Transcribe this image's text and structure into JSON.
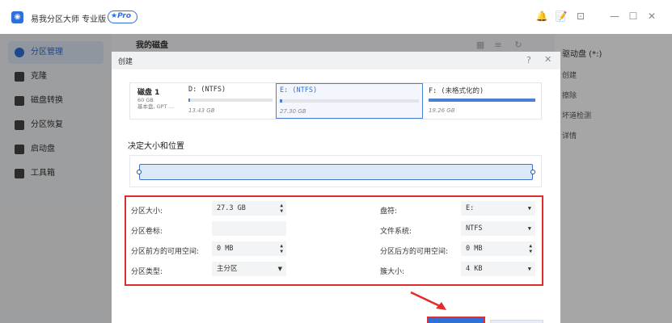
{
  "app": {
    "logo": "◉",
    "title": "易我分区大师 专业版",
    "badge": "★Pro",
    "window_icons": [
      "bell-icon",
      "note-icon",
      "download-icon",
      "minimize-icon",
      "maximize-icon",
      "close-icon"
    ],
    "window_glyphs": [
      "🔔",
      "📝",
      "⊡",
      "—",
      "☐",
      "✕"
    ]
  },
  "sidebar": {
    "items": [
      {
        "label": "分区管理",
        "active": true
      },
      {
        "label": "克隆",
        "active": false
      },
      {
        "label": "磁盘转换",
        "active": false
      },
      {
        "label": "分区恢复",
        "active": false
      },
      {
        "label": "启动盘",
        "active": false
      },
      {
        "label": "工具箱",
        "active": false
      }
    ]
  },
  "main": {
    "header": "我的磁盘",
    "view_glyphs": [
      "▦",
      "≡",
      "↻"
    ]
  },
  "right_panel": {
    "title": "驱动盘 (*:)",
    "items": [
      "创建",
      "擦除",
      "坏道检测",
      "详情"
    ]
  },
  "dialog": {
    "title": "创建",
    "help": "?",
    "close": "✕",
    "disk": {
      "name": "磁盘 1",
      "meta1": "60 GB",
      "meta2": "基本盘, GPT …",
      "partitions": [
        {
          "label": "D: (NTFS)",
          "size": "13.43 GB",
          "usage": 0.02,
          "selected": false
        },
        {
          "label": "E: (NTFS)",
          "size": "27.30 GB",
          "usage": 0.02,
          "selected": true
        },
        {
          "label": "F: (未格式化的)",
          "size": "19.26 GB",
          "usage": 1.0,
          "selected": false
        }
      ]
    },
    "section_title": "决定大小和位置",
    "params": {
      "size_label": "分区大小:",
      "size_value": "27.3 GB",
      "volume_label": "分区卷标:",
      "volume_value": "",
      "before_label": "分区前方的可用空间:",
      "before_value": "0 MB",
      "type_label": "分区类型:",
      "type_value": "主分区",
      "drive_label": "盘符:",
      "drive_value": "E:",
      "fs_label": "文件系统:",
      "fs_value": "NTFS",
      "after_label": "分区后方的可用空间:",
      "after_value": "0 MB",
      "cluster_label": "簇大小:",
      "cluster_value": "4 KB"
    }
  },
  "colors": {
    "accent": "#2f6fd8",
    "highlight": "#e02c2c"
  }
}
